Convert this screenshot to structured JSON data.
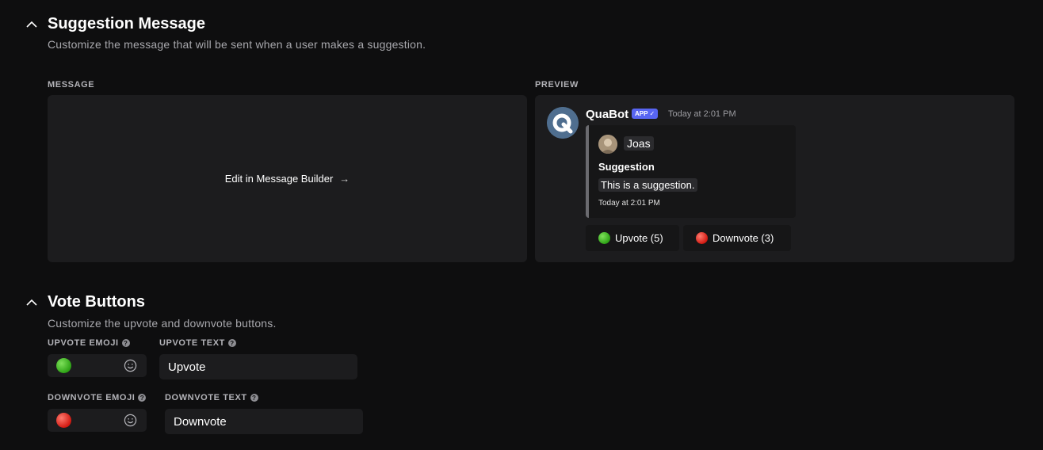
{
  "suggestion_section": {
    "title": "Suggestion Message",
    "description": "Customize the message that will be sent when a user makes a suggestion.",
    "message_label": "MESSAGE",
    "preview_label": "PREVIEW",
    "edit_link": "Edit in Message Builder",
    "edit_arrow": "→"
  },
  "preview": {
    "bot_name": "QuaBot",
    "app_badge": "APP ✓",
    "timestamp": "Today at 2:01 PM",
    "embed": {
      "author": "Joas",
      "title": "Suggestion",
      "description": "This is a suggestion.",
      "footer": "Today at 2:01 PM",
      "border_color": "#6b6b70"
    },
    "buttons": [
      {
        "label": "Upvote (5)",
        "emoji": "green-circle"
      },
      {
        "label": "Downvote (3)",
        "emoji": "red-circle"
      }
    ]
  },
  "vote_section": {
    "title": "Vote Buttons",
    "description": "Customize the upvote and downvote buttons.",
    "upvote_emoji_label": "UPVOTE EMOJI",
    "upvote_text_label": "UPVOTE TEXT",
    "upvote_text_value": "Upvote",
    "downvote_emoji_label": "DOWNVOTE EMOJI",
    "downvote_text_label": "DOWNVOTE TEXT",
    "downvote_text_value": "Downvote",
    "help_glyph": "?"
  },
  "colors": {
    "background": "#0e0e0f",
    "panel": "#1c1c1e",
    "app_badge": "#5865f2",
    "upvote": "#2ea316",
    "downvote": "#d21a12"
  }
}
